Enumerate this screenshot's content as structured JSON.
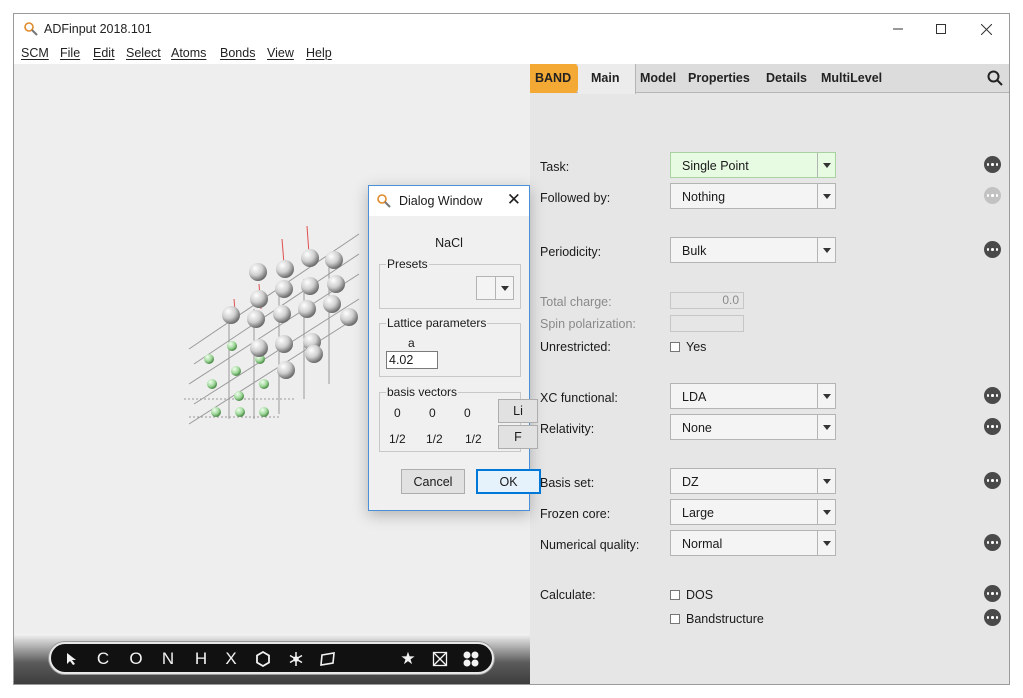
{
  "window": {
    "title": "ADFinput 2018.101"
  },
  "menu": [
    "SCM",
    "File",
    "Edit",
    "Select",
    "Atoms",
    "Bonds",
    "View",
    "Help"
  ],
  "toolbar": {
    "tools": [
      "select-arrow",
      "C",
      "O",
      "N",
      "H",
      "X",
      "hexagon",
      "snowflake",
      "polygon",
      "star",
      "crystal",
      "atoms"
    ],
    "labels": {
      "C": "C",
      "O": "O",
      "N": "N",
      "H": "H",
      "X": "X"
    }
  },
  "tabs": {
    "engine": "BAND",
    "main": "Main",
    "model": "Model",
    "properties": "Properties",
    "details": "Details",
    "multilevel": "MultiLevel"
  },
  "form": {
    "task_label": "Task:",
    "task_value": "Single Point",
    "followed_label": "Followed by:",
    "followed_value": "Nothing",
    "periodicity_label": "Periodicity:",
    "periodicity_value": "Bulk",
    "charge_label": "Total charge:",
    "charge_value": "0.0",
    "spin_label": "Spin polarization:",
    "spin_value": "",
    "unrestricted_label": "Unrestricted:",
    "unrestricted_value": "Yes",
    "xc_label": "XC functional:",
    "xc_value": "LDA",
    "relativity_label": "Relativity:",
    "relativity_value": "None",
    "basis_label": "Basis set:",
    "basis_value": "DZ",
    "core_label": "Frozen core:",
    "core_value": "Large",
    "quality_label": "Numerical quality:",
    "quality_value": "Normal",
    "calculate_label": "Calculate:",
    "dos_label": "DOS",
    "bands_label": "Bandstructure"
  },
  "dialog": {
    "title": "Dialog Window",
    "name": "NaCl",
    "presets_label": "Presets",
    "lattice_label": "Lattice parameters",
    "a_label": "a",
    "a_value": "4.02",
    "basis_label": "basis vectors",
    "rows": [
      {
        "x": "0",
        "y": "0",
        "z": "0",
        "atom": "Li"
      },
      {
        "x": "1/2",
        "y": "1/2",
        "z": "1/2",
        "atom": "F"
      }
    ],
    "cancel": "Cancel",
    "ok": "OK"
  },
  "colors": {
    "band_tab": "#f4a934",
    "task_field": "#e7fbe3"
  }
}
